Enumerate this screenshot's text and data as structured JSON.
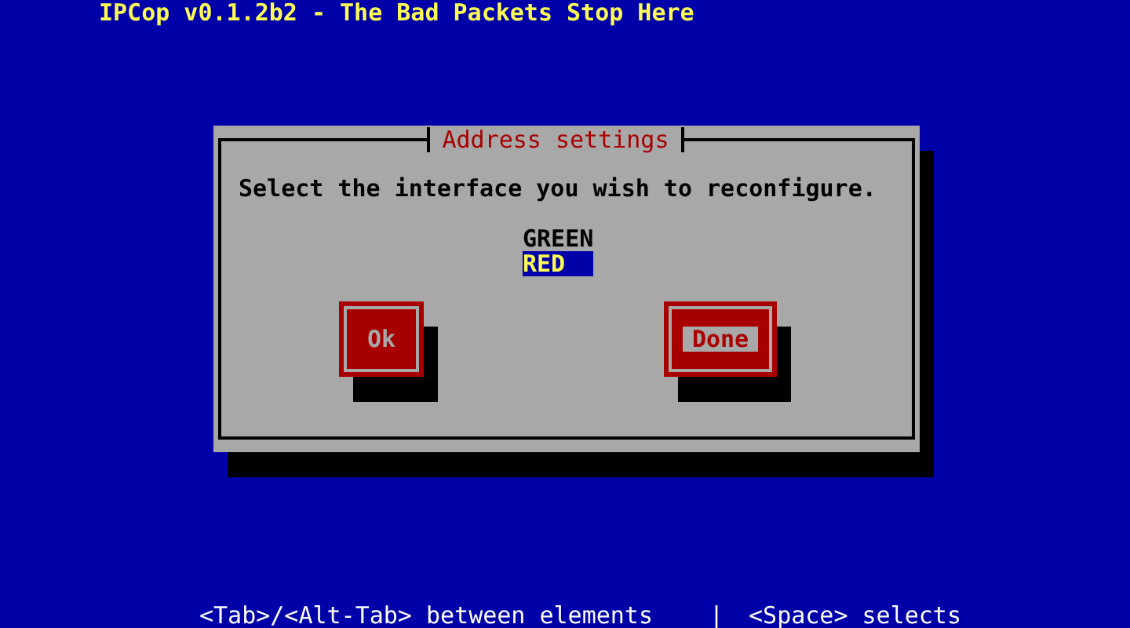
{
  "screen_title": "IPCop v0.1.2b2 - The Bad Packets Stop Here",
  "dialog": {
    "title": "Address settings",
    "prompt": "Select the interface you wish to reconfigure.",
    "interfaces": [
      {
        "label": "GREEN",
        "selected": false
      },
      {
        "label": "RED",
        "selected": true
      }
    ],
    "buttons": [
      {
        "label": "Ok",
        "focused": false
      },
      {
        "label": "Done",
        "focused": true
      }
    ]
  },
  "help_line": [
    "<Tab>/<Alt-Tab> between elements",
    "|",
    "<Space> selects"
  ]
}
